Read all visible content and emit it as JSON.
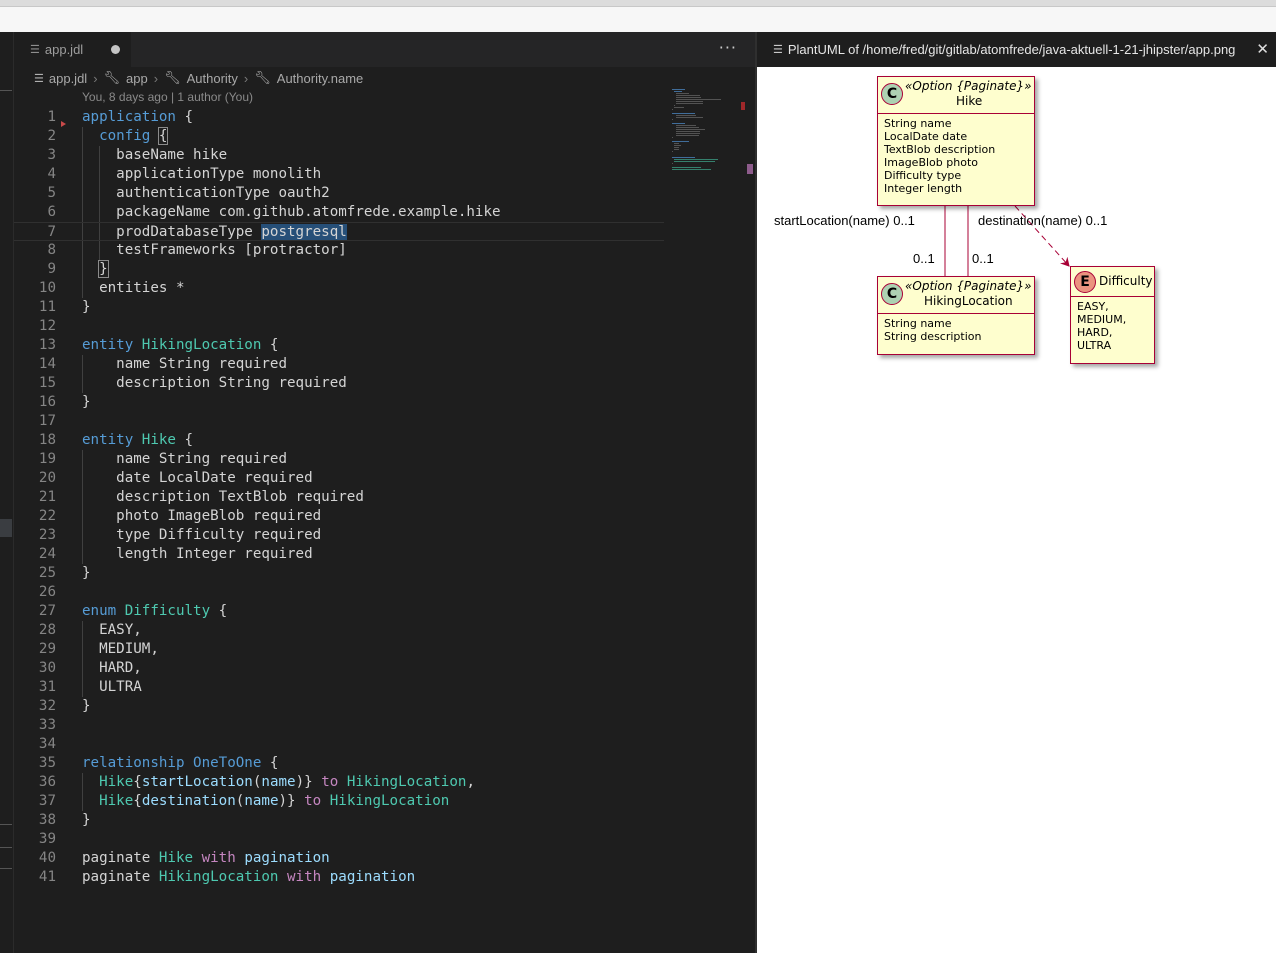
{
  "editor": {
    "tab": {
      "label": "app.jdl"
    },
    "more_label": "···",
    "breadcrumb": [
      "app.jdl",
      "app",
      "Authority",
      "Authority.name"
    ],
    "blame": "You, 8 days ago | 1 author (You)",
    "lines": [
      {
        "n": "1",
        "html": "<span class=\"k\">application</span> {"
      },
      {
        "n": "2",
        "html": "  <span class=\"k\">config</span> <span class=\"bracket-hl\">{</span>"
      },
      {
        "n": "3",
        "html": "    baseName hike"
      },
      {
        "n": "4",
        "html": "    applicationType monolith"
      },
      {
        "n": "5",
        "html": "    authenticationType oauth2"
      },
      {
        "n": "6",
        "html": "    packageName com.github.atomfrede.example.hike"
      },
      {
        "n": "7",
        "html": "    prodDatabaseType <span class=\"hl\">postgresql</span>"
      },
      {
        "n": "8",
        "html": "    testFrameworks [protractor]"
      },
      {
        "n": "9",
        "html": "  <span class=\"bracket-hl\">}</span>"
      },
      {
        "n": "10",
        "html": "  entities *"
      },
      {
        "n": "11",
        "html": "}"
      },
      {
        "n": "12",
        "html": ""
      },
      {
        "n": "13",
        "html": "<span class=\"k\">entity</span> <span class=\"t\">HikingLocation</span> {"
      },
      {
        "n": "14",
        "html": "    name String required"
      },
      {
        "n": "15",
        "html": "    description String required"
      },
      {
        "n": "16",
        "html": "}"
      },
      {
        "n": "17",
        "html": ""
      },
      {
        "n": "18",
        "html": "<span class=\"k\">entity</span> <span class=\"t\">Hike</span> {"
      },
      {
        "n": "19",
        "html": "    name String required"
      },
      {
        "n": "20",
        "html": "    date LocalDate required"
      },
      {
        "n": "21",
        "html": "    description TextBlob required"
      },
      {
        "n": "22",
        "html": "    photo ImageBlob required"
      },
      {
        "n": "23",
        "html": "    type Difficulty required"
      },
      {
        "n": "24",
        "html": "    length Integer required"
      },
      {
        "n": "25",
        "html": "}"
      },
      {
        "n": "26",
        "html": ""
      },
      {
        "n": "27",
        "html": "<span class=\"k\">enum</span> <span class=\"t\">Difficulty</span> {"
      },
      {
        "n": "28",
        "html": "  EASY,"
      },
      {
        "n": "29",
        "html": "  MEDIUM,"
      },
      {
        "n": "30",
        "html": "  HARD,"
      },
      {
        "n": "31",
        "html": "  ULTRA"
      },
      {
        "n": "32",
        "html": "}"
      },
      {
        "n": "33",
        "html": ""
      },
      {
        "n": "34",
        "html": ""
      },
      {
        "n": "35",
        "html": "<span class=\"k\">relationship</span> <span class=\"k\">OneToOne</span> {"
      },
      {
        "n": "36",
        "html": "  <span class=\"t\">Hike</span>{<span class=\"v\">startLocation</span>(<span class=\"v\">name</span>)} <span class=\"p\">to</span> <span class=\"t\">HikingLocation</span>,"
      },
      {
        "n": "37",
        "html": "  <span class=\"t\">Hike</span>{<span class=\"v\">destination</span>(<span class=\"v\">name</span>)} <span class=\"p\">to</span> <span class=\"t\">HikingLocation</span>"
      },
      {
        "n": "38",
        "html": "}"
      },
      {
        "n": "39",
        "html": ""
      },
      {
        "n": "40",
        "html": "paginate <span class=\"t\">Hike</span> <span class=\"p\">with</span> <span class=\"v\">pagination</span>"
      },
      {
        "n": "41",
        "html": "paginate <span class=\"t\">HikingLocation</span> <span class=\"p\">with</span> <span class=\"v\">pagination</span>"
      }
    ]
  },
  "preview": {
    "title": "PlantUML of /home/fred/git/gitlab/atomfrede/java-aktuell-1-21-jhipster/app.png",
    "close_label": "✕",
    "diagram": {
      "hike": {
        "stereotype": "«Option {Paginate}»",
        "name": "Hike",
        "kind": "C",
        "attrs": [
          "String name",
          "LocalDate date",
          "TextBlob description",
          "ImageBlob photo",
          "Difficulty type",
          "Integer length"
        ]
      },
      "hiking_location": {
        "stereotype": "«Option {Paginate}»",
        "name": "HikingLocation",
        "kind": "C",
        "attrs": [
          "String name",
          "String description"
        ]
      },
      "difficulty": {
        "name": "Difficulty",
        "kind": "E",
        "attrs": [
          "EASY,",
          "MEDIUM,",
          "HARD,",
          "ULTRA"
        ]
      },
      "labels": {
        "start_location": "startLocation(name) 0..1",
        "destination": "destination(name) 0..1",
        "mult_left": "0..1",
        "mult_right": "0..1"
      }
    }
  },
  "colors": {
    "editor_bg": "#1e1e1e",
    "keyword": "#569cd6",
    "type": "#4ec9b0",
    "control": "#c586c0",
    "variable": "#9cdcfe",
    "uml_fill": "#fefece",
    "uml_border": "#a80036"
  }
}
